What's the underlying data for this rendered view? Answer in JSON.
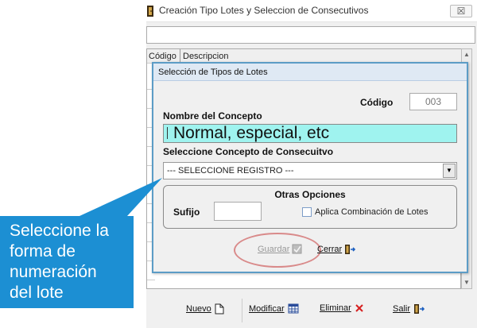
{
  "window": {
    "title": "Creación Tipo Lotes y Seleccion de Consecutivos",
    "close_glyph": "☒"
  },
  "grid": {
    "columns": [
      "Código",
      "Descripcion"
    ]
  },
  "dialog": {
    "title": "Selección de Tipos de Lotes",
    "codigo_label": "Código",
    "codigo_value": "003",
    "nombre_label": "Nombre del Concepto",
    "nombre_value": "Normal, especial, etc",
    "seleccione_label": "Seleccione Concepto de Consecuitvo",
    "select_value": "--- SELECCIONE REGISTRO ---",
    "otras_title": "Otras Opciones",
    "sufijo_label": "Sufijo",
    "sufijo_value": "",
    "checkbox_label": "Aplica Combinación de Lotes",
    "checkbox_checked": false,
    "guardar_label": "Guardar",
    "cerrar_label": "Cerrar"
  },
  "toolbar": {
    "nuevo": "Nuevo",
    "modificar": "Modificar",
    "eliminar": "Eliminar",
    "salir": "Salir"
  },
  "callout": {
    "text": "Seleccione la\nforma de\nnumeración\ndel lote",
    "color": "#1c8fd3"
  },
  "colors": {
    "name_field_bg": "#9ff3ef",
    "dialog_border": "#5c9cc6",
    "eliminar_icon": "#d62020",
    "highlight_ring": "#d98a8a"
  },
  "icons": {
    "window": "door-icon",
    "guardar": "save-icon",
    "cerrar": "exit-door-icon",
    "nuevo": "new-document-icon",
    "modificar": "edit-table-icon",
    "eliminar": "delete-x-icon",
    "salir": "exit-door-icon"
  }
}
